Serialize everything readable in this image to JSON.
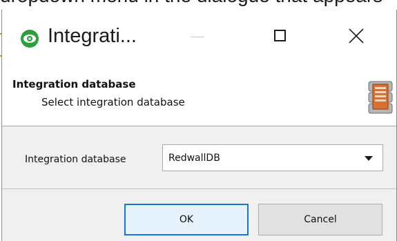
{
  "background_caption": "dropdown menu in the dialogue that appears",
  "window": {
    "title": "Integrati...",
    "app_icon": "eye-icon",
    "controls": [
      "minimize-icon",
      "maximize-icon",
      "close-icon"
    ],
    "close_glyph": "✕"
  },
  "header": {
    "title": "Integration database",
    "subtitle": "Select integration database",
    "icon": "database-icon"
  },
  "form": {
    "label": "Integration database",
    "selected": "RedwallDB"
  },
  "buttons": {
    "ok": "OK",
    "cancel": "Cancel"
  },
  "colors": {
    "accent": "#1a73d9",
    "icon_green": "#2e9e3e",
    "body_bg": "#f0f0f0"
  }
}
